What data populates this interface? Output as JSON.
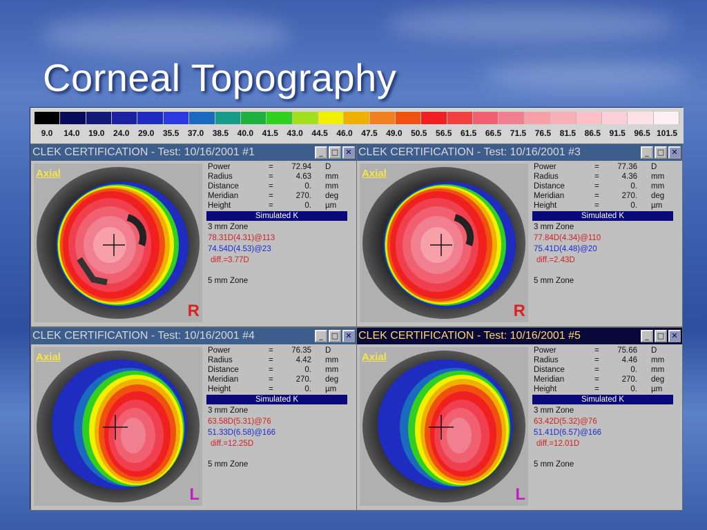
{
  "slide": {
    "title": "Corneal Topography"
  },
  "scale": {
    "colors": [
      "#000000",
      "#0a0a5a",
      "#121a78",
      "#1a22a0",
      "#1e2cc0",
      "#2a3ae0",
      "#1a6abf",
      "#1a9a8a",
      "#20b040",
      "#30d020",
      "#a0e020",
      "#f0f000",
      "#f0b000",
      "#f08020",
      "#f05010",
      "#f02020",
      "#f04040",
      "#f06070",
      "#f08090",
      "#f7a0a8",
      "#f8b0b8",
      "#fbc0c8",
      "#fcd0d8",
      "#fde0e8",
      "#fff0f5"
    ],
    "labels": [
      "9.0",
      "14.0",
      "19.0",
      "24.0",
      "29.0",
      "35.5",
      "37.0",
      "38.5",
      "40.0",
      "41.5",
      "43.0",
      "44.5",
      "46.0",
      "47.5",
      "49.0",
      "50.5",
      "56.5",
      "61.5",
      "66.5",
      "71.5",
      "76.5",
      "81.5",
      "86.5",
      "91.5",
      "96.5",
      "101.5"
    ]
  },
  "titlebar_buttons": {
    "minimize": "_",
    "maximize": "□",
    "close": "✕"
  },
  "windows": [
    {
      "title": "CLEK CERTIFICATION - Test: 10/16/2001 #1",
      "axial": "Axial",
      "eye": "R",
      "power": "72.94",
      "radius": "4.63",
      "distance": "0.",
      "meridian": "270.",
      "height": "0.",
      "zone3_red": "78.31D(4.31)@113",
      "zone3_blue": "74.54D(4.53)@23",
      "diff": "diff.=3.77D"
    },
    {
      "title": "CLEK CERTIFICATION - Test: 10/16/2001 #3",
      "axial": "Axial",
      "eye": "R",
      "power": "77.36",
      "radius": "4.36",
      "distance": "0.",
      "meridian": "270.",
      "height": "0.",
      "zone3_red": "77.84D(4.34)@110",
      "zone3_blue": "75.41D(4.48)@20",
      "diff": "diff.=2.43D"
    },
    {
      "title": "CLEK CERTIFICATION - Test: 10/16/2001 #4",
      "axial": "Axial",
      "eye": "L",
      "power": "76.35",
      "radius": "4.42",
      "distance": "0.",
      "meridian": "270.",
      "height": "0.",
      "zone3_red": "63.58D(5.31)@76",
      "zone3_blue": "51.33D(6.58)@166",
      "diff": "diff.=12.25D"
    },
    {
      "title": "CLEK CERTIFICATION - Test: 10/16/2001 #5",
      "axial": "Axial",
      "eye": "L",
      "power": "75.66",
      "radius": "4.46",
      "distance": "0.",
      "meridian": "270.",
      "height": "0.",
      "zone3_red": "63.42D(5.32)@76",
      "zone3_blue": "51.41D(6.57)@166",
      "diff": "diff.=12.01D"
    }
  ],
  "labels": {
    "power": "Power",
    "radius": "Radius",
    "distance": "Distance",
    "meridian": "Meridian",
    "height": "Height",
    "eq": "=",
    "unit_power": "D",
    "unit_radius": "mm",
    "unit_distance": "mm",
    "unit_meridian": "deg",
    "unit_height": "µm",
    "simulated_k": "Simulated K",
    "zone3": "3 mm Zone",
    "zone5": "5 mm Zone"
  },
  "colors": {
    "eye_R": "#e02020",
    "eye_L": "#c020c0",
    "active_title": "#ffd86b",
    "inactive_title": "#3d5d8c"
  }
}
